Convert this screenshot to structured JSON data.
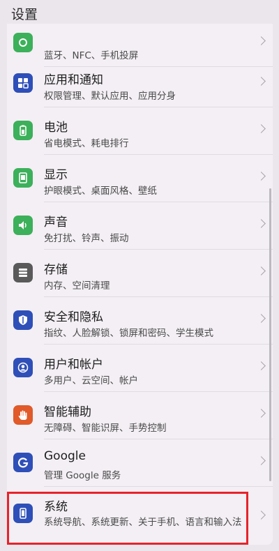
{
  "page_title": "设置",
  "items": [
    {
      "title": "",
      "subtitle": "蓝牙、NFC、手机投屏",
      "icon": "link-icon",
      "color": "#3cb05a"
    },
    {
      "title": "应用和通知",
      "subtitle": "权限管理、默认应用、应用分身",
      "icon": "apps-grid-icon",
      "color": "#2f4fb8"
    },
    {
      "title": "电池",
      "subtitle": "省电模式、耗电排行",
      "icon": "battery-icon",
      "color": "#3cb05a"
    },
    {
      "title": "显示",
      "subtitle": "护眼模式、桌面风格、壁纸",
      "icon": "display-icon",
      "color": "#3cb05a"
    },
    {
      "title": "声音",
      "subtitle": "免打扰、铃声、振动",
      "icon": "speaker-icon",
      "color": "#3cb05a"
    },
    {
      "title": "存储",
      "subtitle": "内存、空间清理",
      "icon": "storage-icon",
      "color": "#5a5a5a"
    },
    {
      "title": "安全和隐私",
      "subtitle": "指纹、人脸解锁、锁屏和密码、学生模式",
      "icon": "shield-icon",
      "color": "#2f4fb8"
    },
    {
      "title": "用户和帐户",
      "subtitle": "多用户、云空间、帐户",
      "icon": "user-icon",
      "color": "#2f4fb8"
    },
    {
      "title": "智能辅助",
      "subtitle": "无障碍、智能识屏、手势控制",
      "icon": "hand-icon",
      "color": "#e05a2a"
    },
    {
      "title": "Google",
      "subtitle": "管理 Google 服务",
      "icon": "google-icon",
      "color": "#2f4fb8"
    },
    {
      "title": "系统",
      "subtitle": "系统导航、系统更新、关于手机、语言和输入法",
      "icon": "phone-icon",
      "color": "#2f4fb8"
    }
  ]
}
